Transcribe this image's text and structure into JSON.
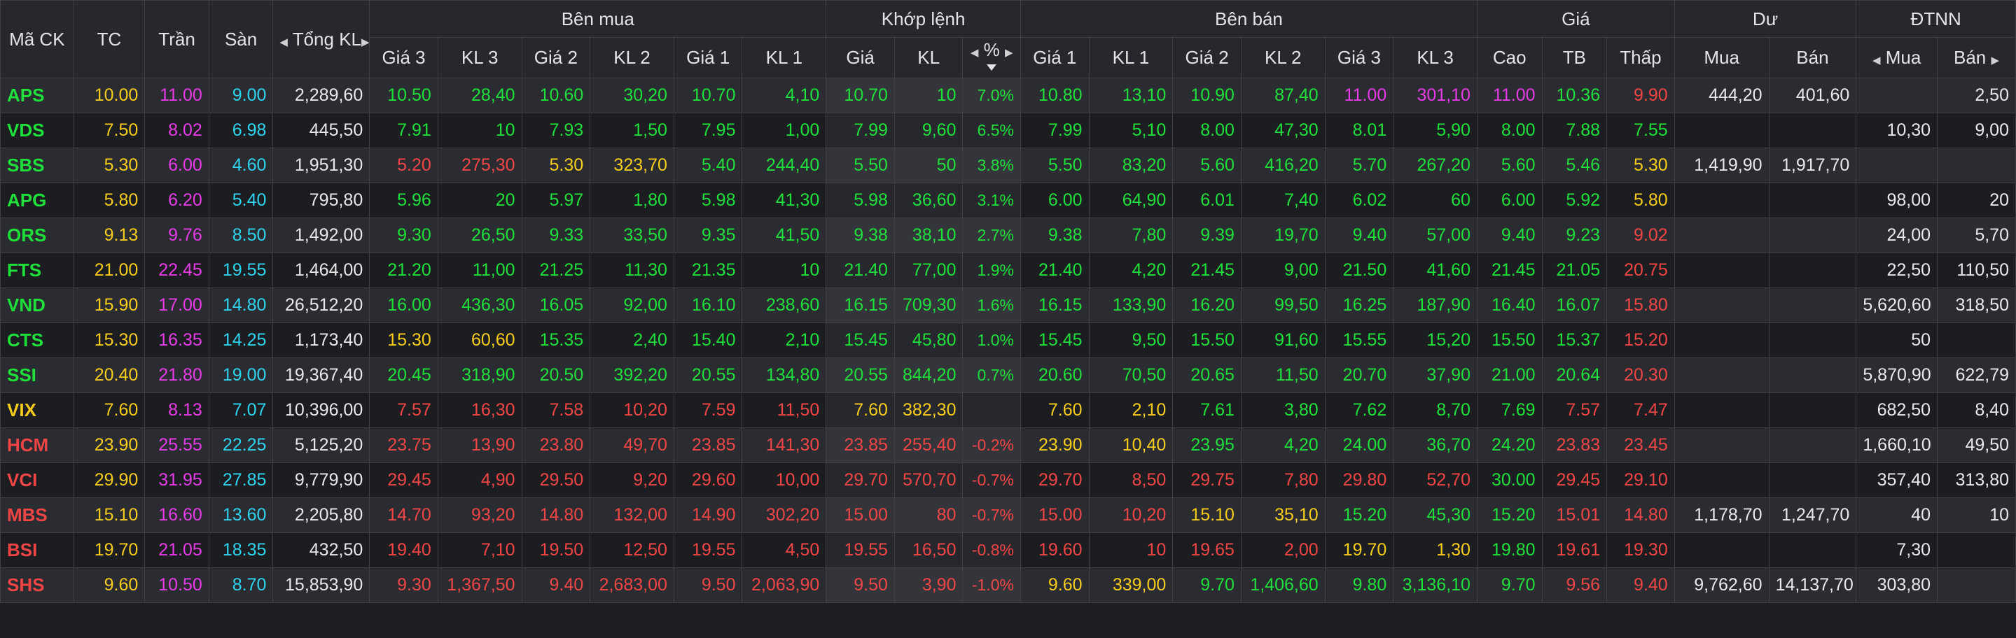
{
  "columns": {
    "symbol": "Mã CK",
    "ref": "TC",
    "ceiling": "Trần",
    "floor": "Sàn",
    "total_volume": "Tổng KL",
    "bid_group": "Bên mua",
    "match_group": "Khớp lệnh",
    "ask_group": "Bên bán",
    "price_group": "Giá",
    "balance_group": "Dư",
    "foreign_group": "ĐTNN",
    "price3": "Giá 3",
    "vol3": "KL 3",
    "price2": "Giá 2",
    "vol2": "KL 2",
    "price1": "Giá 1",
    "vol1": "KL 1",
    "match_price": "Giá",
    "match_vol": "KL",
    "match_pct": "%",
    "high": "Cao",
    "avg": "TB",
    "low": "Thấp",
    "buy": "Mua",
    "sell": "Bán"
  },
  "colors": {
    "up": "#1fe03b",
    "down": "#f04545",
    "reference": "#f6cc1b",
    "ceiling": "#e63be6",
    "floor": "#2ed3ee",
    "neutral": "#e8e8e8",
    "background": "#1e1f23"
  },
  "rows": [
    [
      "APS",
      "10.00",
      "11.00",
      "9.00",
      "2,289,60",
      "10.50",
      "28,40",
      "10.60",
      "30,20",
      "10.70",
      "4,10",
      "10.70",
      "10",
      "7.0%",
      "10.80",
      "13,10",
      "10.90",
      "87,40",
      "11.00",
      "301,10",
      "11.00",
      "10.36",
      "9.90",
      "444,20",
      "401,60",
      "",
      "2,50"
    ],
    [
      "VDS",
      "7.50",
      "8.02",
      "6.98",
      "445,50",
      "7.91",
      "10",
      "7.93",
      "1,50",
      "7.95",
      "1,00",
      "7.99",
      "9,60",
      "6.5%",
      "7.99",
      "5,10",
      "8.00",
      "47,30",
      "8.01",
      "5,90",
      "8.00",
      "7.88",
      "7.55",
      "",
      "",
      "10,30",
      "9,00"
    ],
    [
      "SBS",
      "5.30",
      "6.00",
      "4.60",
      "1,951,30",
      "5.20",
      "275,30",
      "5.30",
      "323,70",
      "5.40",
      "244,40",
      "5.50",
      "50",
      "3.8%",
      "5.50",
      "83,20",
      "5.60",
      "416,20",
      "5.70",
      "267,20",
      "5.60",
      "5.46",
      "5.30",
      "1,419,90",
      "1,917,70",
      "",
      ""
    ],
    [
      "APG",
      "5.80",
      "6.20",
      "5.40",
      "795,80",
      "5.96",
      "20",
      "5.97",
      "1,80",
      "5.98",
      "41,30",
      "5.98",
      "36,60",
      "3.1%",
      "6.00",
      "64,90",
      "6.01",
      "7,40",
      "6.02",
      "60",
      "6.00",
      "5.92",
      "5.80",
      "",
      "",
      "98,00",
      "20"
    ],
    [
      "ORS",
      "9.13",
      "9.76",
      "8.50",
      "1,492,00",
      "9.30",
      "26,50",
      "9.33",
      "33,50",
      "9.35",
      "41,50",
      "9.38",
      "38,10",
      "2.7%",
      "9.38",
      "7,80",
      "9.39",
      "19,70",
      "9.40",
      "57,00",
      "9.40",
      "9.23",
      "9.02",
      "",
      "",
      "24,00",
      "5,70"
    ],
    [
      "FTS",
      "21.00",
      "22.45",
      "19.55",
      "1,464,00",
      "21.20",
      "11,00",
      "21.25",
      "11,30",
      "21.35",
      "10",
      "21.40",
      "77,00",
      "1.9%",
      "21.40",
      "4,20",
      "21.45",
      "9,00",
      "21.50",
      "41,60",
      "21.45",
      "21.05",
      "20.75",
      "",
      "",
      "22,50",
      "110,50"
    ],
    [
      "VND",
      "15.90",
      "17.00",
      "14.80",
      "26,512,20",
      "16.00",
      "436,30",
      "16.05",
      "92,00",
      "16.10",
      "238,60",
      "16.15",
      "709,30",
      "1.6%",
      "16.15",
      "133,90",
      "16.20",
      "99,50",
      "16.25",
      "187,90",
      "16.40",
      "16.07",
      "15.80",
      "",
      "",
      "5,620,60",
      "318,50"
    ],
    [
      "CTS",
      "15.30",
      "16.35",
      "14.25",
      "1,173,40",
      "15.30",
      "60,60",
      "15.35",
      "2,40",
      "15.40",
      "2,10",
      "15.45",
      "45,80",
      "1.0%",
      "15.45",
      "9,50",
      "15.50",
      "91,60",
      "15.55",
      "15,20",
      "15.50",
      "15.37",
      "15.20",
      "",
      "",
      "50",
      ""
    ],
    [
      "SSI",
      "20.40",
      "21.80",
      "19.00",
      "19,367,40",
      "20.45",
      "318,90",
      "20.50",
      "392,20",
      "20.55",
      "134,80",
      "20.55",
      "844,20",
      "0.7%",
      "20.60",
      "70,50",
      "20.65",
      "11,50",
      "20.70",
      "37,90",
      "21.00",
      "20.64",
      "20.30",
      "",
      "",
      "5,870,90",
      "622,79"
    ],
    [
      "VIX",
      "7.60",
      "8.13",
      "7.07",
      "10,396,00",
      "7.57",
      "16,30",
      "7.58",
      "10,20",
      "7.59",
      "11,50",
      "7.60",
      "382,30",
      "",
      "7.60",
      "2,10",
      "7.61",
      "3,80",
      "7.62",
      "8,70",
      "7.69",
      "7.57",
      "7.47",
      "",
      "",
      "682,50",
      "8,40"
    ],
    [
      "HCM",
      "23.90",
      "25.55",
      "22.25",
      "5,125,20",
      "23.75",
      "13,90",
      "23.80",
      "49,70",
      "23.85",
      "141,30",
      "23.85",
      "255,40",
      "-0.2%",
      "23.90",
      "10,40",
      "23.95",
      "4,20",
      "24.00",
      "36,70",
      "24.20",
      "23.83",
      "23.45",
      "",
      "",
      "1,660,10",
      "49,50"
    ],
    [
      "VCI",
      "29.90",
      "31.95",
      "27.85",
      "9,779,90",
      "29.45",
      "4,90",
      "29.50",
      "9,20",
      "29.60",
      "10,00",
      "29.70",
      "570,70",
      "-0.7%",
      "29.70",
      "8,50",
      "29.75",
      "7,80",
      "29.80",
      "52,70",
      "30.00",
      "29.45",
      "29.10",
      "",
      "",
      "357,40",
      "313,80"
    ],
    [
      "MBS",
      "15.10",
      "16.60",
      "13.60",
      "2,205,80",
      "14.70",
      "93,20",
      "14.80",
      "132,00",
      "14.90",
      "302,20",
      "15.00",
      "80",
      "-0.7%",
      "15.00",
      "10,20",
      "15.10",
      "35,10",
      "15.20",
      "45,30",
      "15.20",
      "15.01",
      "14.80",
      "1,178,70",
      "1,247,70",
      "40",
      "10"
    ],
    [
      "BSI",
      "19.70",
      "21.05",
      "18.35",
      "432,50",
      "19.40",
      "7,10",
      "19.50",
      "12,50",
      "19.55",
      "4,50",
      "19.55",
      "16,50",
      "-0.8%",
      "19.60",
      "10",
      "19.65",
      "2,00",
      "19.70",
      "1,30",
      "19.80",
      "19.61",
      "19.30",
      "",
      "",
      "7,30",
      ""
    ],
    [
      "SHS",
      "9.60",
      "10.50",
      "8.70",
      "15,853,90",
      "9.30",
      "1,367,50",
      "9.40",
      "2,683,00",
      "9.50",
      "2,063,90",
      "9.50",
      "3,90",
      "-1.0%",
      "9.60",
      "339,00",
      "9.70",
      "1,406,60",
      "9.80",
      "3,136,10",
      "9.70",
      "9.56",
      "9.40",
      "9,762,60",
      "14,137,70",
      "303,80",
      ""
    ]
  ],
  "row_colors": [
    [
      "up",
      "ref",
      "ceil",
      "flr",
      "wh",
      "up",
      "up",
      "up",
      "up",
      "up",
      "up",
      "up",
      "up",
      "up",
      "up",
      "up",
      "up",
      "up",
      "ceil",
      "ceil",
      "ceil",
      "up",
      "dn",
      "wh",
      "wh",
      "wh",
      "wh"
    ],
    [
      "up",
      "ref",
      "ceil",
      "flr",
      "wh",
      "up",
      "up",
      "up",
      "up",
      "up",
      "up",
      "up",
      "up",
      "up",
      "up",
      "up",
      "up",
      "up",
      "up",
      "up",
      "up",
      "up",
      "up",
      "wh",
      "wh",
      "wh",
      "wh"
    ],
    [
      "up",
      "ref",
      "ceil",
      "flr",
      "wh",
      "dn",
      "dn",
      "ref",
      "ref",
      "up",
      "up",
      "up",
      "up",
      "up",
      "up",
      "up",
      "up",
      "up",
      "up",
      "up",
      "up",
      "up",
      "ref",
      "wh",
      "wh",
      "wh",
      "wh"
    ],
    [
      "up",
      "ref",
      "ceil",
      "flr",
      "wh",
      "up",
      "up",
      "up",
      "up",
      "up",
      "up",
      "up",
      "up",
      "up",
      "up",
      "up",
      "up",
      "up",
      "up",
      "up",
      "up",
      "up",
      "ref",
      "wh",
      "wh",
      "wh",
      "wh"
    ],
    [
      "up",
      "ref",
      "ceil",
      "flr",
      "wh",
      "up",
      "up",
      "up",
      "up",
      "up",
      "up",
      "up",
      "up",
      "up",
      "up",
      "up",
      "up",
      "up",
      "up",
      "up",
      "up",
      "up",
      "dn",
      "wh",
      "wh",
      "wh",
      "wh"
    ],
    [
      "up",
      "ref",
      "ceil",
      "flr",
      "wh",
      "up",
      "up",
      "up",
      "up",
      "up",
      "up",
      "up",
      "up",
      "up",
      "up",
      "up",
      "up",
      "up",
      "up",
      "up",
      "up",
      "up",
      "dn",
      "wh",
      "wh",
      "wh",
      "wh"
    ],
    [
      "up",
      "ref",
      "ceil",
      "flr",
      "wh",
      "up",
      "up",
      "up",
      "up",
      "up",
      "up",
      "up",
      "up",
      "up",
      "up",
      "up",
      "up",
      "up",
      "up",
      "up",
      "up",
      "up",
      "dn",
      "wh",
      "wh",
      "wh",
      "wh"
    ],
    [
      "up",
      "ref",
      "ceil",
      "flr",
      "wh",
      "ref",
      "ref",
      "up",
      "up",
      "up",
      "up",
      "up",
      "up",
      "up",
      "up",
      "up",
      "up",
      "up",
      "up",
      "up",
      "up",
      "up",
      "dn",
      "wh",
      "wh",
      "wh",
      "wh"
    ],
    [
      "up",
      "ref",
      "ceil",
      "flr",
      "wh",
      "up",
      "up",
      "up",
      "up",
      "up",
      "up",
      "up",
      "up",
      "up",
      "up",
      "up",
      "up",
      "up",
      "up",
      "up",
      "up",
      "up",
      "dn",
      "wh",
      "wh",
      "wh",
      "wh"
    ],
    [
      "ref",
      "ref",
      "ceil",
      "flr",
      "wh",
      "dn",
      "dn",
      "dn",
      "dn",
      "dn",
      "dn",
      "ref",
      "ref",
      "ref",
      "ref",
      "ref",
      "up",
      "up",
      "up",
      "up",
      "up",
      "dn",
      "dn",
      "wh",
      "wh",
      "wh",
      "wh"
    ],
    [
      "dn",
      "ref",
      "ceil",
      "flr",
      "wh",
      "dn",
      "dn",
      "dn",
      "dn",
      "dn",
      "dn",
      "dn",
      "dn",
      "dn",
      "ref",
      "ref",
      "up",
      "up",
      "up",
      "up",
      "up",
      "dn",
      "dn",
      "wh",
      "wh",
      "wh",
      "wh"
    ],
    [
      "dn",
      "ref",
      "ceil",
      "flr",
      "wh",
      "dn",
      "dn",
      "dn",
      "dn",
      "dn",
      "dn",
      "dn",
      "dn",
      "dn",
      "dn",
      "dn",
      "dn",
      "dn",
      "dn",
      "dn",
      "up",
      "dn",
      "dn",
      "wh",
      "wh",
      "wh",
      "wh"
    ],
    [
      "dn",
      "ref",
      "ceil",
      "flr",
      "wh",
      "dn",
      "dn",
      "dn",
      "dn",
      "dn",
      "dn",
      "dn",
      "dn",
      "dn",
      "dn",
      "dn",
      "ref",
      "ref",
      "up",
      "up",
      "up",
      "dn",
      "dn",
      "wh",
      "wh",
      "wh",
      "wh"
    ],
    [
      "dn",
      "ref",
      "ceil",
      "flr",
      "wh",
      "dn",
      "dn",
      "dn",
      "dn",
      "dn",
      "dn",
      "dn",
      "dn",
      "dn",
      "dn",
      "dn",
      "dn",
      "dn",
      "ref",
      "ref",
      "up",
      "dn",
      "dn",
      "wh",
      "wh",
      "wh",
      "wh"
    ],
    [
      "dn",
      "ref",
      "ceil",
      "flr",
      "wh",
      "dn",
      "dn",
      "dn",
      "dn",
      "dn",
      "dn",
      "dn",
      "dn",
      "dn",
      "ref",
      "ref",
      "up",
      "up",
      "up",
      "up",
      "up",
      "dn",
      "dn",
      "wh",
      "wh",
      "wh",
      "wh"
    ]
  ]
}
